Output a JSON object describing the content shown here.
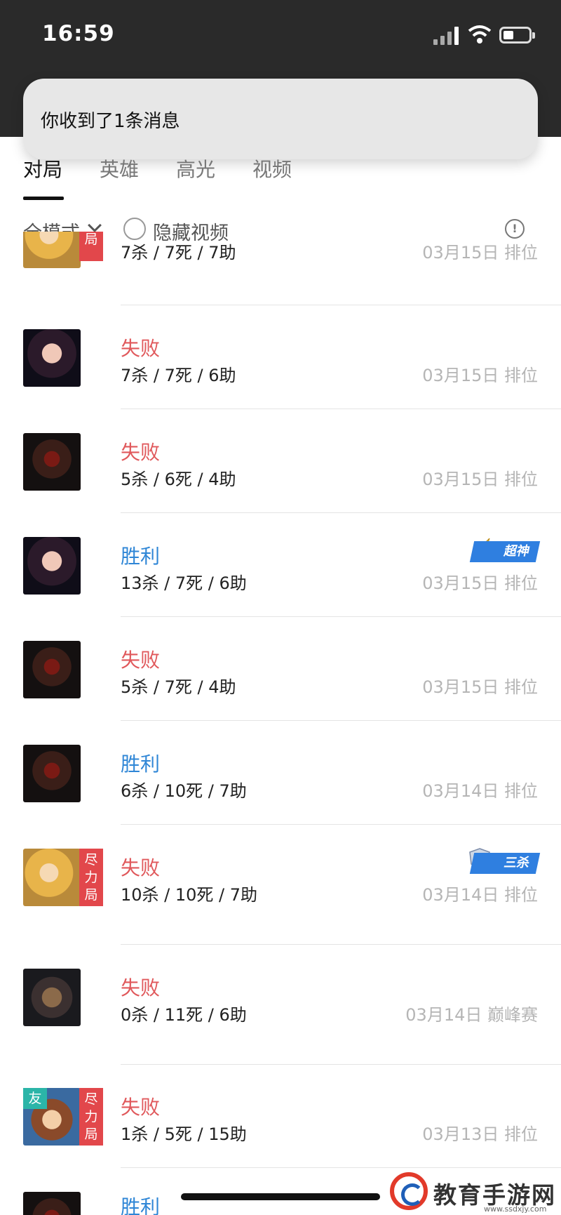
{
  "status_bar": {
    "time": "16:59"
  },
  "notification": {
    "text": "你收到了1条消息"
  },
  "tabs": [
    {
      "label": "对局",
      "active": true
    },
    {
      "label": "英雄",
      "active": false
    },
    {
      "label": "高光",
      "active": false
    },
    {
      "label": "视频",
      "active": false
    }
  ],
  "filter": {
    "mode_label": "全模式",
    "hide_video_label": "隐藏视频",
    "hide_video_checked": false,
    "info_glyph": "!"
  },
  "matches": [
    {
      "result": "",
      "result_type": "",
      "kda": "7杀 / 7死 / 7助",
      "meta": "03月15日 排位",
      "avatar": "hero-c",
      "side_tag": "力局",
      "friend": "",
      "badge": ""
    },
    {
      "result": "失败",
      "result_type": "lose",
      "kda": "7杀 / 7死 / 6助",
      "meta": "03月15日 排位",
      "avatar": "hero-a",
      "side_tag": "",
      "friend": "",
      "badge": ""
    },
    {
      "result": "失败",
      "result_type": "lose",
      "kda": "5杀 / 6死 / 4助",
      "meta": "03月15日 排位",
      "avatar": "hero-b",
      "side_tag": "",
      "friend": "",
      "badge": ""
    },
    {
      "result": "胜利",
      "result_type": "win",
      "kda": "13杀 / 7死 / 6助",
      "meta": "03月15日 排位",
      "avatar": "hero-a",
      "side_tag": "",
      "friend": "",
      "badge": "超神"
    },
    {
      "result": "失败",
      "result_type": "lose",
      "kda": "5杀 / 7死 / 4助",
      "meta": "03月15日 排位",
      "avatar": "hero-b",
      "side_tag": "",
      "friend": "",
      "badge": ""
    },
    {
      "result": "胜利",
      "result_type": "win",
      "kda": "6杀 / 10死 / 7助",
      "meta": "03月14日 排位",
      "avatar": "hero-b",
      "side_tag": "",
      "friend": "",
      "badge": ""
    },
    {
      "result": "失败",
      "result_type": "lose",
      "kda": "10杀 / 10死 / 7助",
      "meta": "03月14日 排位",
      "avatar": "hero-c",
      "side_tag": "尽力局",
      "friend": "",
      "badge": "三杀"
    },
    {
      "result": "失败",
      "result_type": "lose",
      "kda": "0杀 / 11死 / 6助",
      "meta": "03月14日 巅峰赛",
      "avatar": "hero-d",
      "side_tag": "",
      "friend": "",
      "badge": ""
    },
    {
      "result": "失败",
      "result_type": "lose",
      "kda": "1杀 / 5死 / 15助",
      "meta": "03月13日 排位",
      "avatar": "hero-e",
      "side_tag": "尽力局",
      "friend": "友",
      "badge": ""
    },
    {
      "result": "胜利",
      "result_type": "win",
      "kda": "",
      "meta": "",
      "avatar": "hero-b",
      "side_tag": "",
      "friend": "",
      "badge": ""
    }
  ],
  "watermark": {
    "text": "教育手游网",
    "url": "www.ssdxjy.com"
  },
  "colors": {
    "lose": "#e0585b",
    "win": "#2f86d6",
    "badge": "#2f7fe0",
    "side_tag": "#e2474b",
    "friend_tag": "#2bb5a8"
  }
}
